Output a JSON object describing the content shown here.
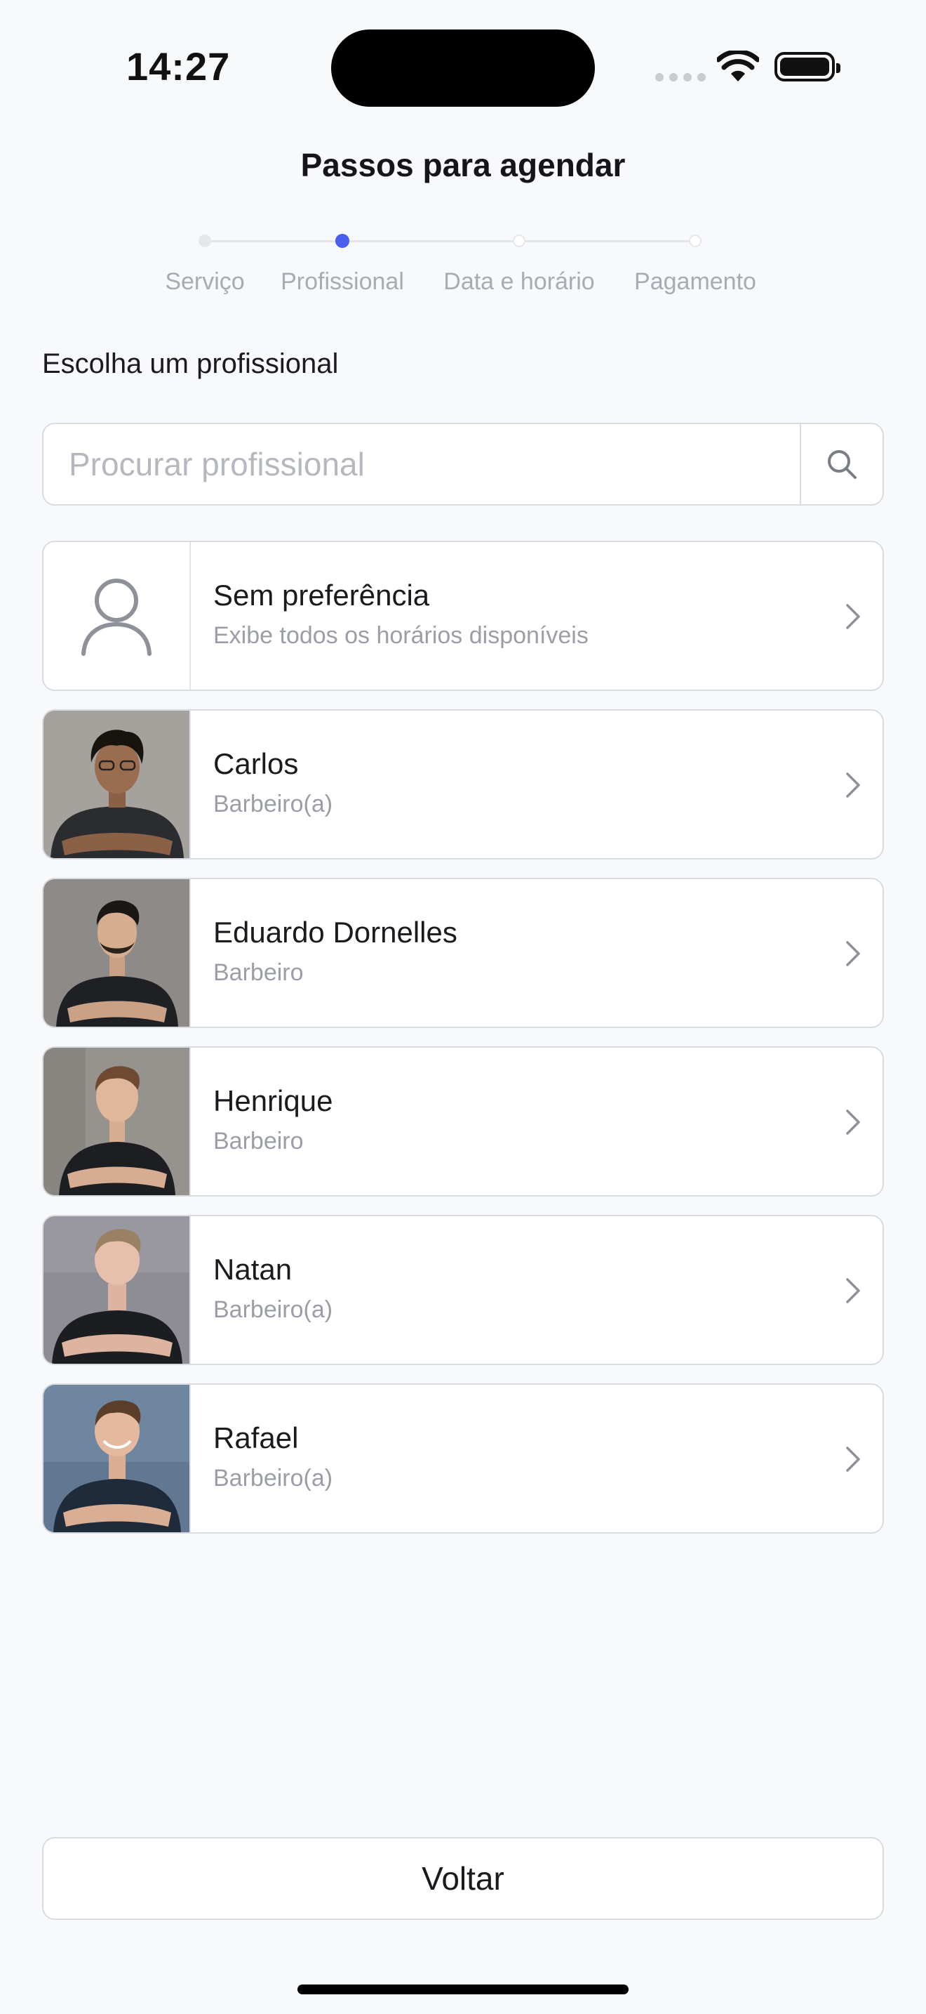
{
  "status_bar": {
    "time": "14:27"
  },
  "header": {
    "title": "Passos para agendar"
  },
  "steps": [
    {
      "label": "Serviço",
      "state": "done"
    },
    {
      "label": "Profissional",
      "state": "active"
    },
    {
      "label": "Data e horário",
      "state": "pending"
    },
    {
      "label": "Pagamento",
      "state": "pending"
    }
  ],
  "colors": {
    "accent": "#4a5ef0",
    "background": "#f8f9fb",
    "border": "#d9dbe0"
  },
  "section": {
    "label": "Escolha um profissional"
  },
  "search": {
    "placeholder": "Procurar profissional",
    "value": "",
    "icon": "search-icon"
  },
  "professionals": [
    {
      "name": "Sem preferência",
      "subtitle": "Exibe todos os horários disponíveis",
      "avatar": "user-placeholder-icon"
    },
    {
      "name": "Carlos",
      "subtitle": "Barbeiro(a)",
      "avatar": "photo"
    },
    {
      "name": "Eduardo Dornelles",
      "subtitle": "Barbeiro",
      "avatar": "photo"
    },
    {
      "name": "Henrique",
      "subtitle": "Barbeiro",
      "avatar": "photo"
    },
    {
      "name": "Natan",
      "subtitle": "Barbeiro(a)",
      "avatar": "photo"
    },
    {
      "name": "Rafael",
      "subtitle": "Barbeiro(a)",
      "avatar": "photo"
    }
  ],
  "footer": {
    "back_label": "Voltar"
  }
}
